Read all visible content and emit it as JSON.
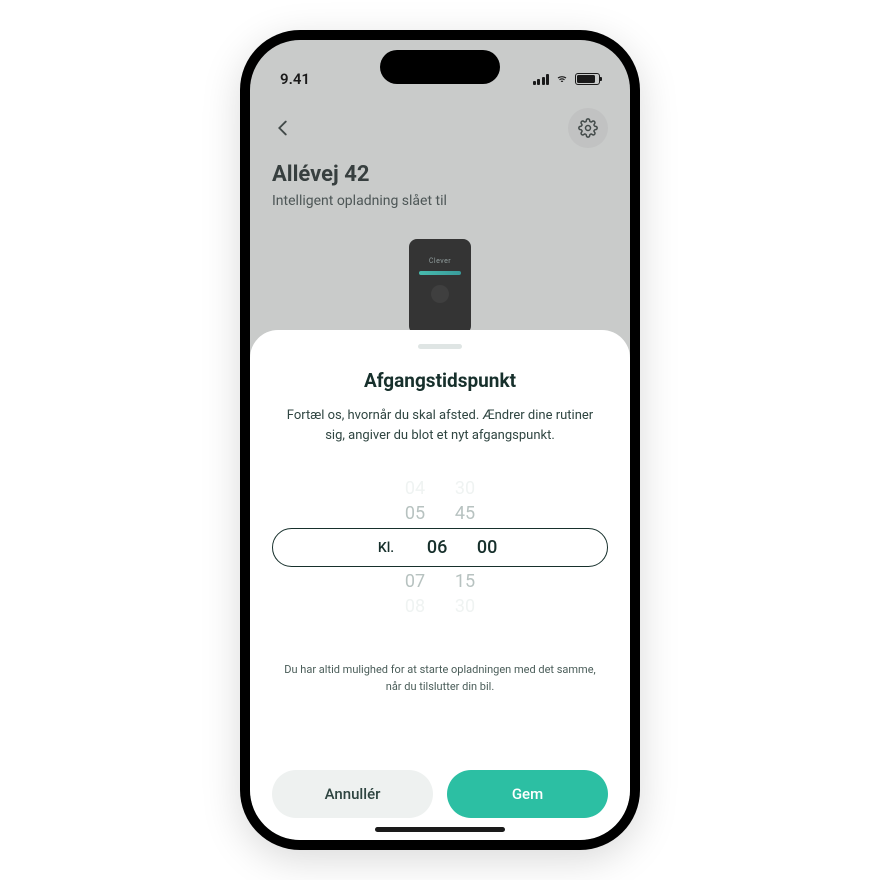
{
  "status": {
    "time": "9.41"
  },
  "header": {
    "title": "Allévej 42",
    "subtitle": "Intelligent opladning slået til"
  },
  "sheet": {
    "title": "Afgangstidspunkt",
    "description": "Fortæl os, hvornår du skal afsted. Ændrer dine rutiner sig, angiver du blot et nyt afgangspunkt.",
    "kl_label": "Kl.",
    "picker": {
      "hours": [
        "04",
        "05",
        "06",
        "07",
        "08"
      ],
      "minutes": [
        "30",
        "45",
        "00",
        "15",
        "30"
      ],
      "selected_index": 2
    },
    "hint": "Du har altid mulighed for at starte opladningen med det samme, når du tilslutter din bil.",
    "cancel_label": "Annullér",
    "save_label": "Gem"
  },
  "colors": {
    "accent": "#2cbfa3",
    "dark": "#17302c"
  }
}
